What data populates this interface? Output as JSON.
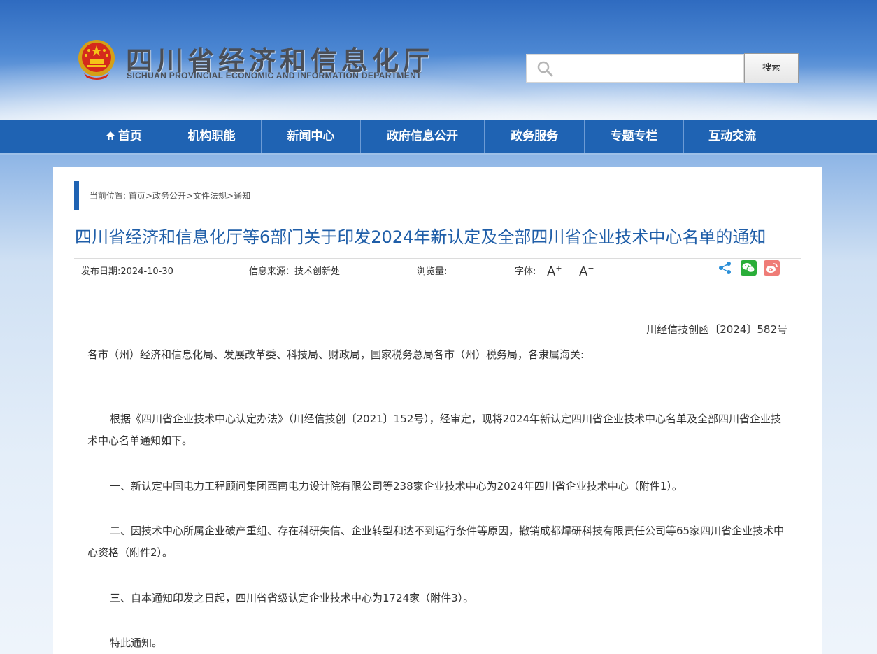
{
  "header": {
    "title": "四川省经济和信息化厅",
    "subtitle": "SICHUAN PROVINCIAL ECONOMIC AND INFORMATION DEPARTMENT",
    "search_placeholder": "",
    "search_button": "搜索"
  },
  "nav": {
    "items": [
      {
        "label": "首页",
        "icon": "home-icon"
      },
      {
        "label": "机构职能"
      },
      {
        "label": "新闻中心"
      },
      {
        "label": "政府信息公开"
      },
      {
        "label": "政务服务"
      },
      {
        "label": "专题专栏"
      },
      {
        "label": "互动交流"
      }
    ]
  },
  "breadcrumb": {
    "prefix": "当前位置:",
    "items": [
      "首页",
      "政务公开",
      "文件法规",
      "通知"
    ],
    "separator": ">"
  },
  "article": {
    "title": "四川省经济和信息化厅等6部门关于印发2024年新认定及全部四川省企业技术中心名单的通知",
    "publish_date": "发布日期:2024-10-30",
    "source": "信息来源：技术创新处",
    "views": "浏览量:",
    "font_label": "字体:",
    "font_increase": "A",
    "font_decrease": "A",
    "doc_number": "川经信技创函〔2024〕582号",
    "salutation": "各市（州）经济和信息化局、发展改革委、科技局、财政局，国家税务总局各市（州）税务局，各隶属海关:",
    "para1": "根据《四川省企业技术中心认定办法》（川经信技创〔2021〕152号），经审定，现将2024年新认定四川省企业技术中心名单及全部四川省企业技术中心名单通知如下。",
    "para2": "一、新认定中国电力工程顾问集团西南电力设计院有限公司等238家企业技术中心为2024年四川省企业技术中心（附件1）。",
    "para3": "二、因技术中心所属企业破产重组、存在科研失信、企业转型和达不到运行条件等原因，撤销成都焊研科技有限责任公司等65家四川省企业技术中心资格（附件2）。",
    "para4": "三、自本通知印发之日起，四川省省级认定企业技术中心为1724家（附件3）。",
    "para5": "特此通知。"
  },
  "colors": {
    "nav_bg": "#1f63b3",
    "title_blue": "#1f5ea8",
    "wechat_green": "#2aae39",
    "weibo_pink": "#ef7c77"
  }
}
